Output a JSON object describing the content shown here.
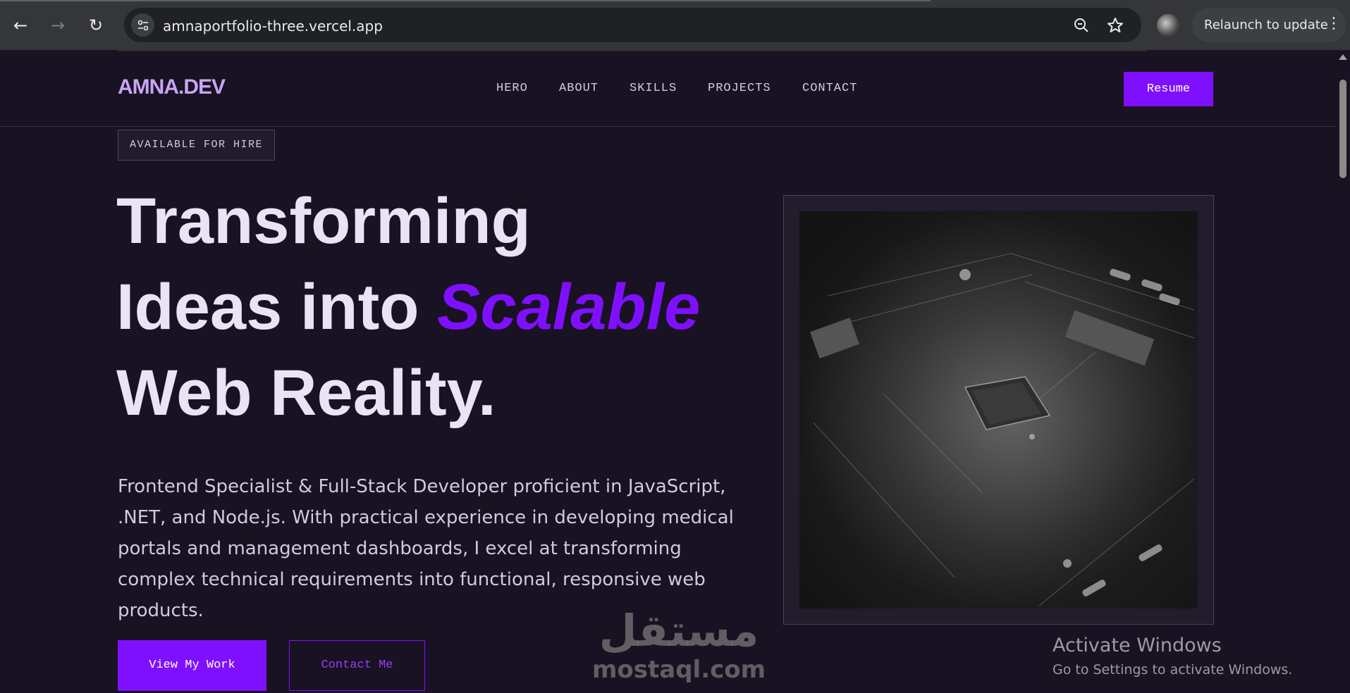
{
  "browser": {
    "url": "amnaportfolio-three.vercel.app",
    "relaunch_label": "Relaunch to update",
    "icons": [
      "back-arrow-icon",
      "forward-arrow-icon",
      "reload-icon",
      "site-info-icon",
      "zoom-icon",
      "bookmark-star-icon",
      "profile-avatar",
      "more-vert-icon"
    ]
  },
  "header": {
    "logo": "AMNA.DEV",
    "nav": [
      "HERO",
      "ABOUT",
      "SKILLS",
      "PROJECTS",
      "CONTACT"
    ],
    "resume_label": "Resume"
  },
  "hero": {
    "badge": "AVAILABLE FOR HIRE",
    "headline_line1": "Transforming",
    "headline_line2_a": "Ideas into ",
    "headline_line2_accent": "Scalable",
    "headline_line3": "Web Reality.",
    "description": "Frontend Specialist & Full-Stack Developer proficient in JavaScript, .NET, and Node.js. With practical experience in developing medical portals and management dashboards, I excel at transforming complex technical requirements into functional, responsive web products.",
    "primary_button": "View My Work",
    "secondary_button": "Contact Me"
  },
  "overlay": {
    "watermark_arabic": "مستقل",
    "watermark_latin": "mostaql.com",
    "activate_title": "Activate Windows",
    "activate_sub": "Go to Settings to activate Windows."
  },
  "colors": {
    "accent": "#7f10ff",
    "background": "#191222",
    "logo": "#c9a4f5"
  }
}
